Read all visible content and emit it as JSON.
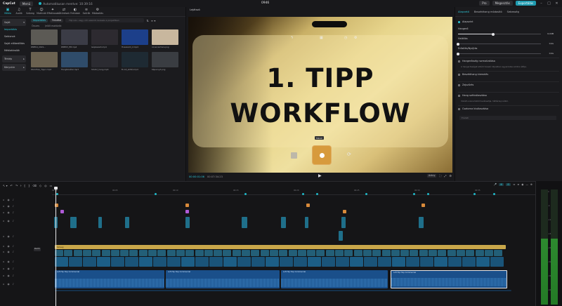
{
  "topbar": {
    "logo": "CapCut",
    "menu": "Menü",
    "autosave": "Automatikusan mentve: 10:39:16",
    "project_title": "0946",
    "pro_btn": "Pro",
    "share_btn": "Megosztás",
    "export_btn": "Exportálás",
    "min": "–",
    "max": "□",
    "close": "✕"
  },
  "media": {
    "tabs": [
      {
        "icon": "▣",
        "label": "Média"
      },
      {
        "icon": "♫",
        "label": "Audió"
      },
      {
        "icon": "T",
        "label": "Szöveg"
      },
      {
        "icon": "☺",
        "label": "Matricák"
      },
      {
        "icon": "✦",
        "label": "Effektusok"
      },
      {
        "icon": "⇄",
        "label": "Áttűnések"
      },
      {
        "icon": "◐",
        "label": "Feliratok"
      },
      {
        "icon": "≋",
        "label": "Szűrők"
      },
      {
        "icon": "⚙",
        "label": "Módosítás"
      }
    ],
    "side": [
      {
        "label": "Saját",
        "type": "sel",
        "chev": "▾"
      },
      {
        "label": "Importálás",
        "type": "active"
      },
      {
        "label": "Sablonok",
        "type": ""
      },
      {
        "label": "Saját előbeállítás",
        "type": ""
      },
      {
        "label": "Médiatárolók",
        "type": ""
      },
      {
        "label": "Térkép",
        "type": "sel",
        "chev": "▸"
      },
      {
        "label": "Könyvtár",
        "type": "sel",
        "chev": "▸"
      }
    ],
    "toolbar": {
      "import": "Importálás",
      "folder": "Felvétel",
      "search_placeholder": "Fájl név, vagy cím szerinti keresés a projektben",
      "sort": "⇅",
      "filter": "≡ ▾"
    },
    "filter_row": {
      "all": "Összes",
      "hint": "Jelölt eszközök"
    },
    "thumbs": [
      {
        "caption": "RMEK4_2021...",
        "color": "#5c5a55"
      },
      {
        "caption": "RMEK5_HB.mp4",
        "color": "#3b3c46"
      },
      {
        "caption": "Gépkezelő.mp4",
        "color": "#2d2a30"
      },
      {
        "caption": "Hosszanti_2.mp4",
        "color": "#1c3f8a"
      },
      {
        "caption": "cover-lecture.png",
        "color": "#c8b79e"
      },
      {
        "caption": "Workflow_Tipp1.mp4",
        "color": "#6a6150"
      },
      {
        "caption": "Hangfelvétel.mp3",
        "color": "#2f4c6a"
      },
      {
        "caption": "Stúdió_hang.mp4",
        "color": "#2b2b31"
      },
      {
        "caption": "B-roll_előtér.mp4",
        "color": "#1e2a33"
      },
      {
        "caption": "Képernyő.png",
        "color": "#3a3d42"
      }
    ]
  },
  "player": {
    "title": "Lejátszó",
    "headline_1": "1. TIPP",
    "headline_2": "WORKFLOW",
    "size_label": "Méret",
    "timecode_current": "00:00:01:06",
    "timecode_total": "00:07:34:23",
    "play": "▶",
    "ratio": "Arány",
    "controls_right": [
      "⛶",
      "⤢",
      "⚙"
    ]
  },
  "props": {
    "tabs": [
      "Alapvető",
      "Beszédhang módosító",
      "Sebesség"
    ],
    "rows": [
      {
        "label": "Alapszint",
        "checked": true,
        "value": "",
        "type": "header"
      },
      {
        "label": "Hangerő",
        "value": "0,0dB",
        "fill": 0.42,
        "type": "slider"
      },
      {
        "label": "Halkítás",
        "value": "0,0s",
        "fill": 0.0,
        "type": "slider"
      },
      {
        "label": "Erősítés/Nyújtás",
        "value": "0,0s",
        "fill": 0.0,
        "type": "slider"
      },
      {
        "label": "Hangerősség normalizálása",
        "checked": false,
        "type": "toggle",
        "desc": "A hangerősséget eltérő hosszú klipekben egyenletes szintre állítja."
      },
      {
        "label": "Beszédhang kiemelés",
        "checked": false,
        "type": "toggle",
        "desc": ""
      },
      {
        "label": "Zajszűrés",
        "checked": false,
        "type": "toggle",
        "desc": ""
      },
      {
        "label": "Hang szétválasztása",
        "checked": false,
        "type": "toggle",
        "desc": "Vokált a zeneműből leválasztja, háttérzaj nélkül."
      },
      {
        "label": "Csatorna kiválasztása",
        "checked": false,
        "type": "toggle",
        "desc": ""
      }
    ],
    "select_placeholder": "Eredeti"
  },
  "timeline": {
    "toolbar_left": [
      "↖ ▾",
      "↶",
      "↷",
      "⟊",
      "⟦",
      "⟧",
      "⌫",
      "◇",
      "◎",
      "▭"
    ],
    "toolbar_right": [
      "🎤",
      "⊞",
      "⊟",
      "⇔",
      "≡",
      "◉",
      "—",
      "⊕"
    ],
    "ruler_labels": [
      "00:00",
      "00:05",
      "00:10",
      "00:15",
      "00:20",
      "00:25",
      "00:30",
      "00:35",
      "00:40"
    ],
    "text_track_label": "Szöveg",
    "audio_clip_label": "Lofi Hip Hop Commercial",
    "cover": "Borító"
  },
  "meter": {
    "labels": [
      "0",
      "-6",
      "-12",
      "-18",
      "-24",
      "-30",
      "-36",
      "-42"
    ]
  },
  "colors": {
    "accent": "#2ec8d8",
    "video_clip": "#1f6f8a",
    "text_clip": "#c9a74a",
    "audio_clip": "#1a4f8a"
  }
}
